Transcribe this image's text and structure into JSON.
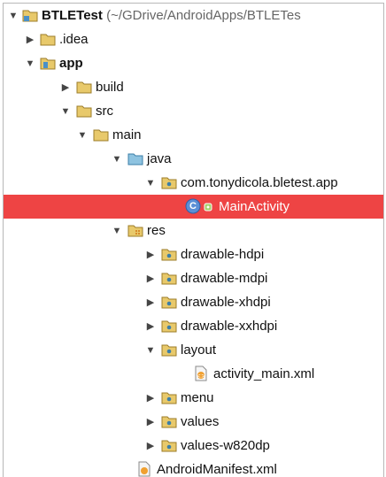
{
  "tree": {
    "root": {
      "label": "BTLETest",
      "path": " (~/GDrive/AndroidApps/BTLETes"
    },
    "items": [
      {
        "label": ".idea"
      },
      {
        "label": "app"
      },
      {
        "label": "build"
      },
      {
        "label": "src"
      },
      {
        "label": "main"
      },
      {
        "label": "java"
      },
      {
        "label": "com.tonydicola.bletest.app"
      },
      {
        "label": "MainActivity"
      },
      {
        "label": "res"
      },
      {
        "label": "drawable-hdpi"
      },
      {
        "label": "drawable-mdpi"
      },
      {
        "label": "drawable-xhdpi"
      },
      {
        "label": "drawable-xxhdpi"
      },
      {
        "label": "layout"
      },
      {
        "label": "activity_main.xml"
      },
      {
        "label": "menu"
      },
      {
        "label": "values"
      },
      {
        "label": "values-w820dp"
      },
      {
        "label": "AndroidManifest.xml"
      }
    ],
    "class_badge": "C",
    "colors": {
      "selection": "#ee4444",
      "folder": "#e8c96b",
      "package_folder": "#8ec3e0",
      "module_badge": "#4a90c8"
    }
  }
}
